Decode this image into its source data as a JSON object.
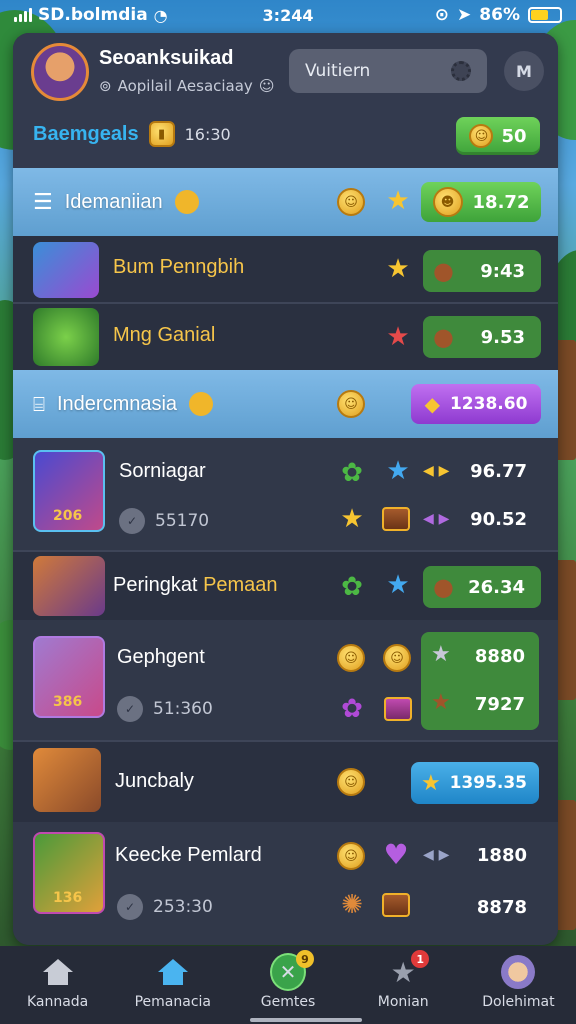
{
  "status_bar": {
    "carrier": "SD.bolmdia",
    "time": "3:244",
    "battery_pct": "86%"
  },
  "header": {
    "player_name": "Seoanksuikad",
    "player_sub": "Aopilail Aesaciaay",
    "search_value": "Vuitiern",
    "menu_label": "M",
    "title": "Baemgeals",
    "timer": "16:30",
    "coins": "50"
  },
  "sections": [
    {
      "label": "Idemaniian",
      "value": "18.72"
    },
    {
      "label": "Indercmnasia",
      "value": "1238.60"
    }
  ],
  "rows": [
    {
      "name": "Bum Penngbih",
      "value": "9:43"
    },
    {
      "name": "Mng Ganial",
      "value": "9.53"
    },
    {
      "name": "Sorniagar",
      "sub": "55170",
      "badge": "206",
      "value_top": "96.77",
      "value_bottom": "90.52"
    },
    {
      "name_a": "Peringkat",
      "name_b": "Pemaan",
      "value": "26.34"
    },
    {
      "name": "Gephgent",
      "sub": "51:360",
      "badge": "386",
      "value_top": "8880",
      "value_bottom": "7927"
    },
    {
      "name": "Juncbaly",
      "value": "1395.35"
    },
    {
      "name": "Keecke Pemlard",
      "sub": "253:30",
      "badge": "136",
      "value_top": "1880",
      "value_bottom": "8878"
    }
  ],
  "nav": [
    {
      "label": "Kannada",
      "icon": "home-icon"
    },
    {
      "label": "Pemanacia",
      "icon": "home-icon"
    },
    {
      "label": "Gemtes",
      "icon": "game-icon",
      "badge": "9"
    },
    {
      "label": "Monian",
      "icon": "star-icon",
      "badge": "1"
    },
    {
      "label": "Dolehimat",
      "icon": "profile-icon"
    }
  ],
  "colors": {
    "panel": "#2d3344",
    "section": "#6eaede",
    "green_pill": "#4cb844",
    "purple_pill": "#a552e0",
    "blue_pill": "#2a9ad8",
    "accent_title": "#37b4f0",
    "gold_text": "#f6c54a"
  }
}
